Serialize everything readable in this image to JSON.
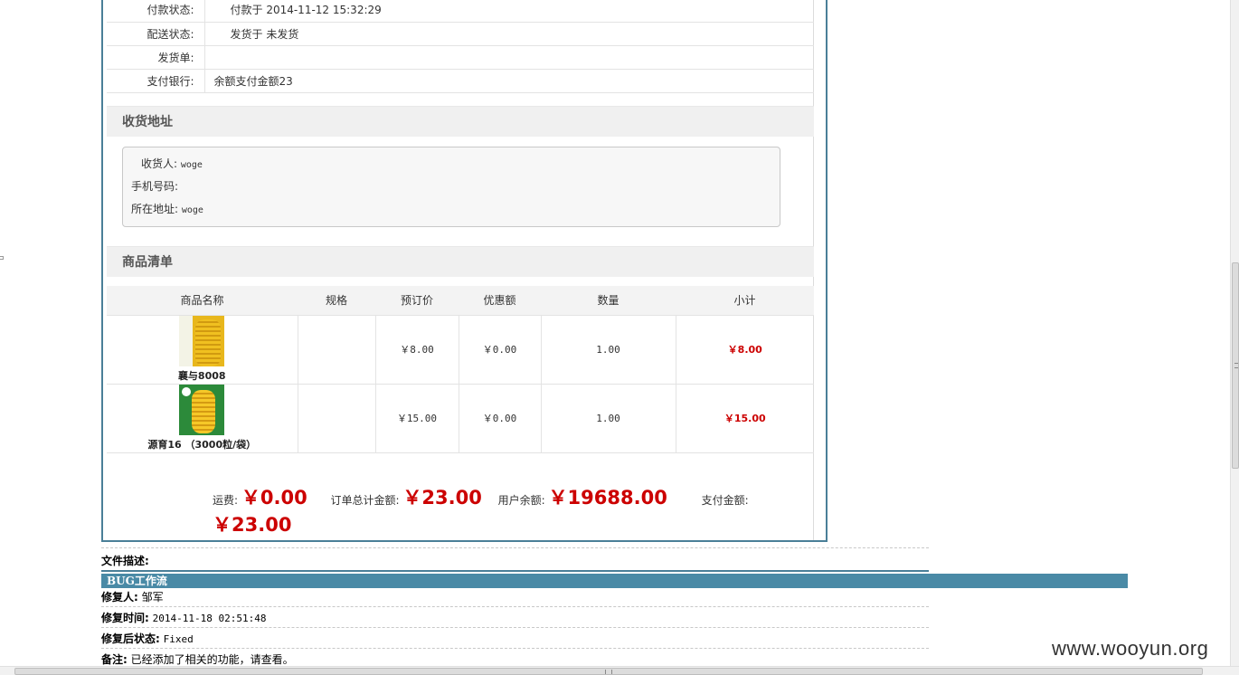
{
  "order_info": [
    {
      "label": "付款状态:",
      "value": "付款于 2014-11-12 15:32:29"
    },
    {
      "label": "配送状态:",
      "value": "发货于 未发货"
    },
    {
      "label": "发货单:",
      "value": ""
    },
    {
      "label": "支付银行:",
      "value": "余额支付金额23"
    }
  ],
  "address_section": {
    "title": "收货地址",
    "consignee_label": "收货人:",
    "consignee": "woge",
    "phone_label": "手机号码:",
    "phone": "",
    "address_label": "所在地址:",
    "address": "woge"
  },
  "goods_section": {
    "title": "商品清单",
    "headers": [
      "商品名称",
      "规格",
      "预订价",
      "优惠额",
      "数量",
      "小计"
    ],
    "rows": [
      {
        "name": "襄与8008",
        "spec": "",
        "price": "￥8.00",
        "discount": "￥0.00",
        "qty": "1.00",
        "subtotal": "￥8.00"
      },
      {
        "name": "源育16 （3000粒/袋）",
        "spec": "",
        "price": "￥15.00",
        "discount": "￥0.00",
        "qty": "1.00",
        "subtotal": "￥15.00"
      }
    ]
  },
  "totals": {
    "shipping_label": "运费:",
    "shipping": "￥0.00",
    "order_total_label": "订单总计金额:",
    "order_total": "￥23.00",
    "balance_label": "用户余额:",
    "balance": "￥19688.00",
    "pay_label": "支付金额:",
    "pay": "￥23.00"
  },
  "bug": {
    "file_desc_label": "文件描述:",
    "workflow_title": "BUG工作流",
    "fixer_label": "修复人:",
    "fixer": "邹军",
    "fix_time_label": "修复时间:",
    "fix_time": "2014-11-18 02:51:48",
    "status_label": "修复后状态:",
    "status": "Fixed",
    "note_label": "备注:",
    "note": "已经添加了相关的功能，请查看。"
  },
  "watermark": "www.wooyun.org",
  "colors": {
    "accent": "#4a8aa6",
    "price_red": "#cc0000",
    "border_blue": "#4a7f98"
  }
}
